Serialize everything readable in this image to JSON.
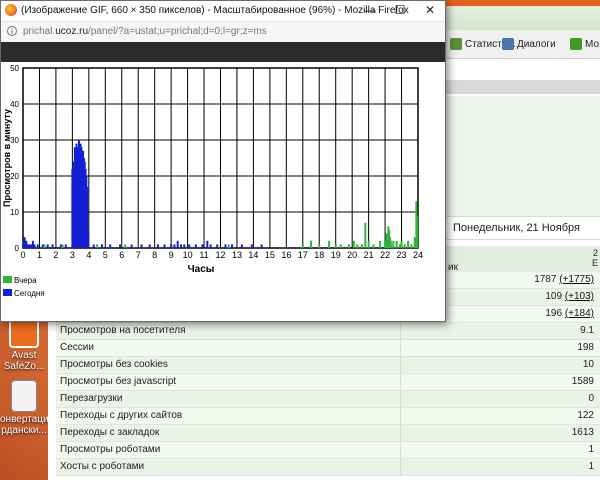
{
  "firefox": {
    "title": "(Изображение GIF, 660 × 350 пикселов) - Масштабированное (96%) - Mozilla Firefox",
    "url_prefix": "prichal.",
    "url_domain": "ucoz.ru",
    "url_path": "/panel/?a=ustat;u=prichal;d=0;l=gr;z=ms",
    "buttons": {
      "minimize": "—",
      "maximize": "☐",
      "close": "✕"
    },
    "info_icon": "i"
  },
  "chart_data": {
    "type": "bar",
    "ylabel": "Просмотров в минуту",
    "xlabel": "Часы",
    "ylim": [
      0,
      50
    ],
    "xlim": [
      0,
      24
    ],
    "y_ticks": [
      "0",
      "10",
      "20",
      "30",
      "40",
      "50"
    ],
    "x_ticks": [
      "0",
      "1",
      "2",
      "3",
      "4",
      "5",
      "6",
      "7",
      "8",
      "9",
      "10",
      "11",
      "12",
      "13",
      "14",
      "15",
      "16",
      "17",
      "18",
      "19",
      "20",
      "21",
      "22",
      "23",
      "24"
    ],
    "grid": true,
    "legend": [
      {
        "name": "Вчера",
        "color": "#2db53a"
      },
      {
        "name": "Сегодня",
        "color": "#1420d6"
      }
    ],
    "series": [
      {
        "name": "Сегодня",
        "color": "#1420d6",
        "points": [
          [
            0.05,
            2
          ],
          [
            0.1,
            3
          ],
          [
            0.2,
            2
          ],
          [
            0.3,
            1
          ],
          [
            0.4,
            1
          ],
          [
            0.5,
            1
          ],
          [
            0.6,
            2
          ],
          [
            0.7,
            1
          ],
          [
            0.9,
            1
          ],
          [
            1.2,
            1
          ],
          [
            1.5,
            1
          ],
          [
            1.8,
            1
          ],
          [
            2.3,
            1
          ],
          [
            2.6,
            1
          ],
          [
            3.0,
            22
          ],
          [
            3.05,
            21
          ],
          [
            3.1,
            24
          ],
          [
            3.15,
            28
          ],
          [
            3.2,
            27
          ],
          [
            3.25,
            29
          ],
          [
            3.3,
            28
          ],
          [
            3.35,
            26
          ],
          [
            3.4,
            30
          ],
          [
            3.45,
            27
          ],
          [
            3.5,
            29
          ],
          [
            3.55,
            28
          ],
          [
            3.6,
            26
          ],
          [
            3.65,
            27
          ],
          [
            3.7,
            25
          ],
          [
            3.75,
            24
          ],
          [
            3.8,
            22
          ],
          [
            3.85,
            20
          ],
          [
            3.9,
            17
          ],
          [
            3.95,
            5
          ],
          [
            4.3,
            1
          ],
          [
            4.8,
            1
          ],
          [
            5.3,
            1
          ],
          [
            5.9,
            1
          ],
          [
            6.6,
            1
          ],
          [
            7.2,
            1
          ],
          [
            7.7,
            1
          ],
          [
            8.2,
            1
          ],
          [
            8.6,
            1
          ],
          [
            9.0,
            1
          ],
          [
            9.2,
            1
          ],
          [
            9.4,
            2
          ],
          [
            9.6,
            1
          ],
          [
            9.8,
            1
          ],
          [
            10.1,
            1
          ],
          [
            10.5,
            1
          ],
          [
            10.9,
            1
          ],
          [
            11.2,
            2
          ],
          [
            11.4,
            1
          ],
          [
            11.8,
            1
          ],
          [
            12.3,
            1
          ],
          [
            12.7,
            1
          ],
          [
            13.3,
            1
          ],
          [
            13.9,
            1
          ],
          [
            14.5,
            1
          ]
        ]
      },
      {
        "name": "Вчера",
        "color": "#2db53a",
        "points": [
          [
            1.3,
            1
          ],
          [
            2.4,
            1
          ],
          [
            4.5,
            1
          ],
          [
            6.2,
            1
          ],
          [
            12.5,
            1
          ],
          [
            17.0,
            1
          ],
          [
            17.5,
            2
          ],
          [
            18.0,
            1
          ],
          [
            18.6,
            2
          ],
          [
            19.0,
            1
          ],
          [
            19.3,
            1
          ],
          [
            19.8,
            1
          ],
          [
            20.1,
            2
          ],
          [
            20.3,
            1
          ],
          [
            20.6,
            1
          ],
          [
            20.8,
            7
          ],
          [
            21.0,
            2
          ],
          [
            21.3,
            1
          ],
          [
            21.7,
            2
          ],
          [
            22.0,
            2
          ],
          [
            22.1,
            4
          ],
          [
            22.2,
            6
          ],
          [
            22.25,
            5
          ],
          [
            22.3,
            3
          ],
          [
            22.35,
            2
          ],
          [
            22.5,
            2
          ],
          [
            22.7,
            2
          ],
          [
            22.9,
            1
          ],
          [
            23.0,
            2
          ],
          [
            23.2,
            1
          ],
          [
            23.4,
            2
          ],
          [
            23.6,
            1
          ],
          [
            23.8,
            3
          ],
          [
            23.9,
            13
          ],
          [
            23.95,
            9
          ]
        ]
      }
    ]
  },
  "background_page": {
    "tabs": [
      {
        "label": "Статисти...",
        "icon": "stats-tab-icon",
        "color": "#5a8f3a"
      },
      {
        "label": "Диалоги",
        "icon": "vk-tab-icon",
        "color": "#4a76a8"
      },
      {
        "label": "Мо",
        "icon": "ok-tab-icon",
        "color": "#3f9a27"
      }
    ],
    "date": "Понедельник, 21 Ноября",
    "header_left": "ик",
    "header_right_line1": "2",
    "header_right_line2": "Е",
    "stats": [
      {
        "label": "",
        "value": "1787",
        "delta": "(+1775)"
      },
      {
        "label": "",
        "value": "109",
        "delta": "(+103)"
      },
      {
        "label": "",
        "value": "196",
        "delta": "(+184)"
      },
      {
        "label": "Просмотров на посетителя",
        "value": "9.1",
        "delta": ""
      },
      {
        "label": "Сессии",
        "value": "198",
        "delta": ""
      },
      {
        "label": "Просмотры без cookies",
        "value": "10",
        "delta": ""
      },
      {
        "label": "Просмотры без javascript",
        "value": "1589",
        "delta": ""
      },
      {
        "label": "Перезагрузки",
        "value": "0",
        "delta": ""
      },
      {
        "label": "Переходы с других сайтов",
        "value": "122",
        "delta": ""
      },
      {
        "label": "Переходы с закладок",
        "value": "1613",
        "delta": ""
      },
      {
        "label": "Просмотры роботами",
        "value": "1",
        "delta": ""
      },
      {
        "label": "Хосты с роботами",
        "value": "1",
        "delta": ""
      }
    ]
  },
  "desktop": {
    "icons": [
      {
        "label": "Avast SafeZo...",
        "icon": "avast-icon"
      },
      {
        "label": "онвертация рдански...",
        "icon": "document-icon"
      }
    ]
  }
}
